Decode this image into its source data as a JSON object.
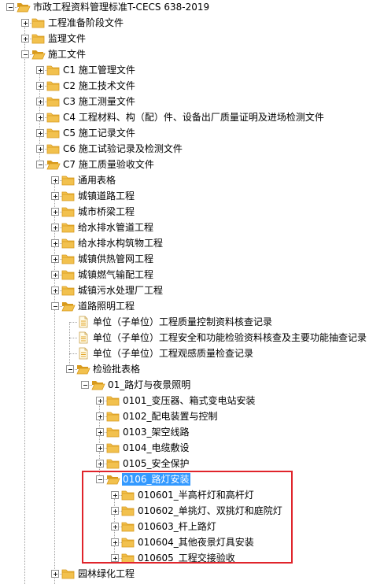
{
  "tree": [
    {
      "label": "市政工程资料管理标准T-CECS 638-2019",
      "depth": 0,
      "icon": "folder-open-icon",
      "toggle": "expanded"
    },
    {
      "label": "工程准备阶段文件",
      "depth": 1,
      "icon": "folder-icon",
      "toggle": "collapsed"
    },
    {
      "label": "监理文件",
      "depth": 1,
      "icon": "folder-icon",
      "toggle": "collapsed"
    },
    {
      "label": "施工文件",
      "depth": 1,
      "icon": "folder-open-icon",
      "toggle": "expanded"
    },
    {
      "label": "C1 施工管理文件",
      "depth": 2,
      "icon": "folder-icon",
      "toggle": "collapsed"
    },
    {
      "label": "C2 施工技术文件",
      "depth": 2,
      "icon": "folder-icon",
      "toggle": "collapsed"
    },
    {
      "label": "C3 施工测量文件",
      "depth": 2,
      "icon": "folder-icon",
      "toggle": "collapsed"
    },
    {
      "label": "C4 工程材料、构（配）件、设备出厂质量证明及进场检测文件",
      "depth": 2,
      "icon": "folder-icon",
      "toggle": "collapsed"
    },
    {
      "label": "C5 施工记录文件",
      "depth": 2,
      "icon": "folder-icon",
      "toggle": "collapsed"
    },
    {
      "label": "C6 施工试验记录及检测文件",
      "depth": 2,
      "icon": "folder-icon",
      "toggle": "collapsed"
    },
    {
      "label": "C7 施工质量验收文件",
      "depth": 2,
      "icon": "folder-open-icon",
      "toggle": "expanded"
    },
    {
      "label": "通用表格",
      "depth": 3,
      "icon": "folder-icon",
      "toggle": "collapsed"
    },
    {
      "label": "城镇道路工程",
      "depth": 3,
      "icon": "folder-icon",
      "toggle": "collapsed"
    },
    {
      "label": "城市桥梁工程",
      "depth": 3,
      "icon": "folder-icon",
      "toggle": "collapsed"
    },
    {
      "label": "给水排水管道工程",
      "depth": 3,
      "icon": "folder-icon",
      "toggle": "collapsed"
    },
    {
      "label": "给水排水构筑物工程",
      "depth": 3,
      "icon": "folder-icon",
      "toggle": "collapsed"
    },
    {
      "label": "城镇供热管网工程",
      "depth": 3,
      "icon": "folder-icon",
      "toggle": "collapsed"
    },
    {
      "label": "城镇燃气输配工程",
      "depth": 3,
      "icon": "folder-icon",
      "toggle": "collapsed"
    },
    {
      "label": "城镇污水处理厂工程",
      "depth": 3,
      "icon": "folder-icon",
      "toggle": "collapsed"
    },
    {
      "label": "道路照明工程",
      "depth": 3,
      "icon": "folder-open-icon",
      "toggle": "expanded"
    },
    {
      "label": "单位（子单位）工程质量控制资料核查记录",
      "depth": 4,
      "icon": "document-icon",
      "toggle": "none"
    },
    {
      "label": "单位（子单位）工程安全和功能检验资料核查及主要功能抽查记录",
      "depth": 4,
      "icon": "document-icon",
      "toggle": "none"
    },
    {
      "label": "单位（子单位）工程观感质量检查记录",
      "depth": 4,
      "icon": "document-icon",
      "toggle": "none"
    },
    {
      "label": "检验批表格",
      "depth": 4,
      "icon": "folder-open-icon",
      "toggle": "expanded"
    },
    {
      "label": "01_路灯与夜景照明",
      "depth": 5,
      "icon": "folder-open-icon",
      "toggle": "expanded"
    },
    {
      "label": "0101_变压器、箱式变电站安装",
      "depth": 6,
      "icon": "folder-icon",
      "toggle": "collapsed"
    },
    {
      "label": "0102_配电装置与控制",
      "depth": 6,
      "icon": "folder-icon",
      "toggle": "collapsed"
    },
    {
      "label": "0103_架空线路",
      "depth": 6,
      "icon": "folder-icon",
      "toggle": "collapsed"
    },
    {
      "label": "0104_电缆敷设",
      "depth": 6,
      "icon": "folder-icon",
      "toggle": "collapsed"
    },
    {
      "label": "0105_安全保护",
      "depth": 6,
      "icon": "folder-icon",
      "toggle": "collapsed"
    },
    {
      "label": "0106_路灯安装",
      "depth": 6,
      "icon": "folder-open-icon",
      "toggle": "expanded",
      "selected": true
    },
    {
      "label": "010601_半高杆灯和高杆灯",
      "depth": 7,
      "icon": "folder-icon",
      "toggle": "collapsed"
    },
    {
      "label": "010602_单挑灯、双挑灯和庭院灯",
      "depth": 7,
      "icon": "folder-icon",
      "toggle": "collapsed"
    },
    {
      "label": "010603_杆上路灯",
      "depth": 7,
      "icon": "folder-icon",
      "toggle": "collapsed"
    },
    {
      "label": "010604_其他夜景灯具安装",
      "depth": 7,
      "icon": "folder-icon",
      "toggle": "collapsed"
    },
    {
      "label": "010605_工程交接验收",
      "depth": 7,
      "icon": "folder-icon",
      "toggle": "collapsed"
    },
    {
      "label": "园林绿化工程",
      "depth": 3,
      "icon": "folder-icon",
      "toggle": "collapsed"
    }
  ],
  "colors": {
    "folder": "#f2c14e",
    "folder_dark": "#d89a1c",
    "selection": "#3399ff",
    "highlight_box": "#e0242b"
  }
}
